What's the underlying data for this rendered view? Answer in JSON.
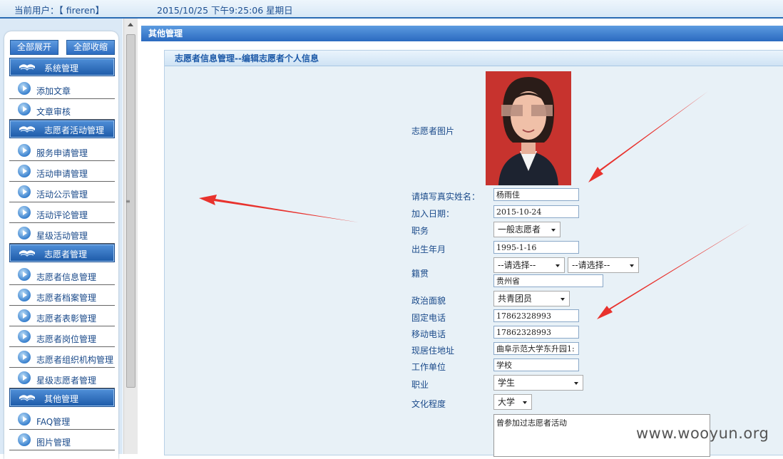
{
  "topbar": {
    "user": "当前用户：【 fireren】",
    "datetime": "2015/10/25 下午9:25:06 星期日"
  },
  "sidebar": {
    "expand_all": "全部展开",
    "collapse_all": "全部收缩",
    "groups": [
      {
        "title": "系统管理",
        "items": [
          "添加文章",
          "文章审核"
        ]
      },
      {
        "title": "志愿者活动管理",
        "items": [
          "服务申请管理",
          "活动申请管理",
          "活动公示管理",
          "活动评论管理",
          "星级活动管理"
        ]
      },
      {
        "title": "志愿者管理",
        "items": [
          "志愿者信息管理",
          "志愿者档案管理",
          "志愿者表彰管理",
          "志愿者岗位管理",
          "志愿者组织机构管理",
          "星级志愿者管理"
        ]
      },
      {
        "title": "其他管理",
        "items": [
          "FAQ管理",
          "图片管理"
        ]
      }
    ]
  },
  "main": {
    "header": "其他管理",
    "subheader": "志愿者信息管理--编辑志愿者个人信息"
  },
  "form": {
    "photo_label": "志愿者图片",
    "name_label": "请填写真实姓名：",
    "name_value": "杨雨佳",
    "join_label": "加入日期：",
    "join_value": "2015-10-24",
    "duty_label": "职务",
    "duty_value": "一般志愿者",
    "birth_label": "出生年月",
    "birth_value": "1995-1-16",
    "native_label": "籍贯",
    "native_select1": "--请选择--",
    "native_select2": "--请选择--",
    "native_value": "贵州省",
    "political_label": "政治面貌",
    "political_value": "共青团员",
    "phone_label": "固定电话",
    "phone_value": "17862328993",
    "mobile_label": "移动电话",
    "mobile_value": "17862328993",
    "address_label": "现居住地址",
    "address_value": "曲阜示范大学东升园1:",
    "work_label": "工作单位",
    "work_value": "学校",
    "job_label": "职业",
    "job_value": "学生",
    "edu_label": "文化程度",
    "edu_value": "大学",
    "experience_value": "曾参加过志愿者活动"
  },
  "watermark": "www.wooyun.org",
  "colors": {
    "accent": "#2b6cb3",
    "arrow": "#e8322d",
    "photo_bg": "#c7332e"
  }
}
